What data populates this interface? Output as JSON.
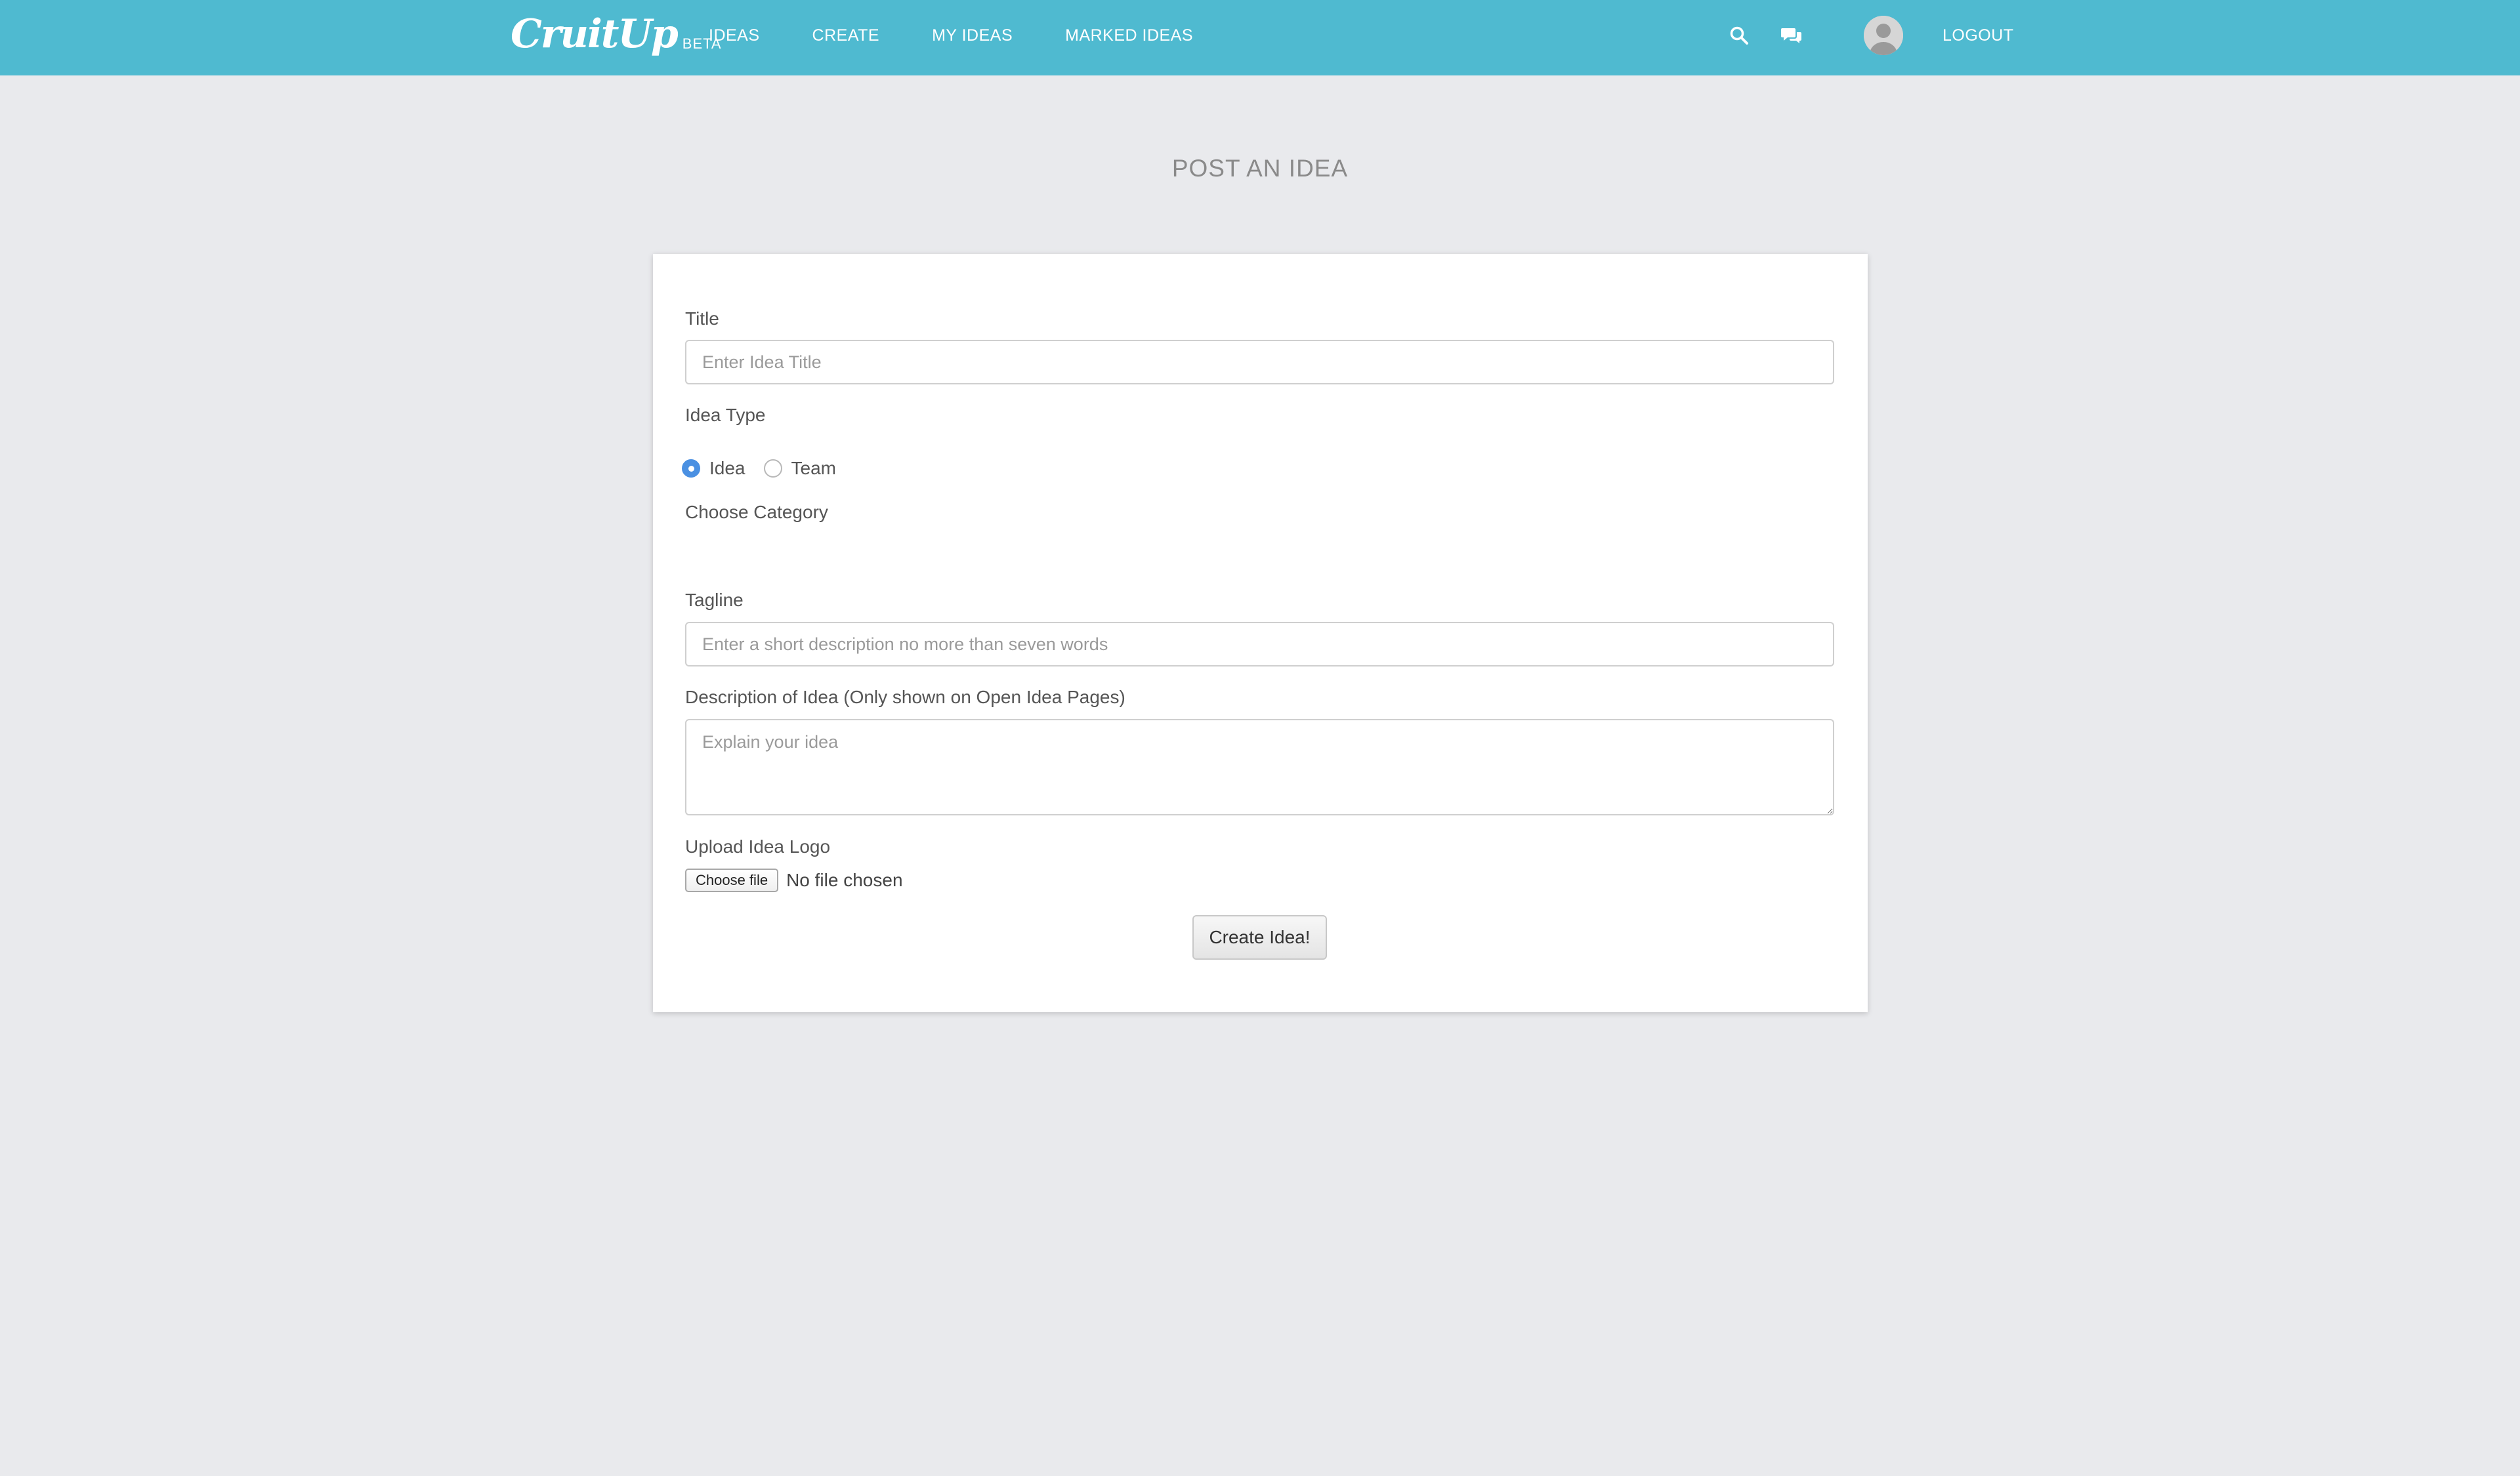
{
  "nav": {
    "brand": "CruitUp",
    "beta": "BETA",
    "links": [
      "IDEAS",
      "CREATE",
      "MY IDEAS",
      "MARKED IDEAS"
    ],
    "logout": "LOGOUT",
    "icons": [
      "search-icon",
      "chat-icon",
      "avatar-icon"
    ]
  },
  "page": {
    "title": "POST AN IDEA"
  },
  "form": {
    "title_label": "Title",
    "title_placeholder": "Enter Idea Title",
    "idea_type_label": "Idea Type",
    "idea_type_options": [
      {
        "label": "Idea",
        "selected": true
      },
      {
        "label": "Team",
        "selected": false
      }
    ],
    "category_label": "Choose Category",
    "tagline_label": "Tagline",
    "tagline_placeholder": "Enter a short description no more than seven words",
    "description_label": "Description of Idea (Only shown on Open Idea Pages)",
    "description_placeholder": "Explain your idea",
    "logo_label": "Upload Idea Logo",
    "file_button": "Choose file",
    "file_status": "No file chosen",
    "submit": "Create Idea!"
  },
  "colors": {
    "navbar": "#4fbad0",
    "background": "#e9eaed",
    "radio_selected": "#4a90e2"
  }
}
